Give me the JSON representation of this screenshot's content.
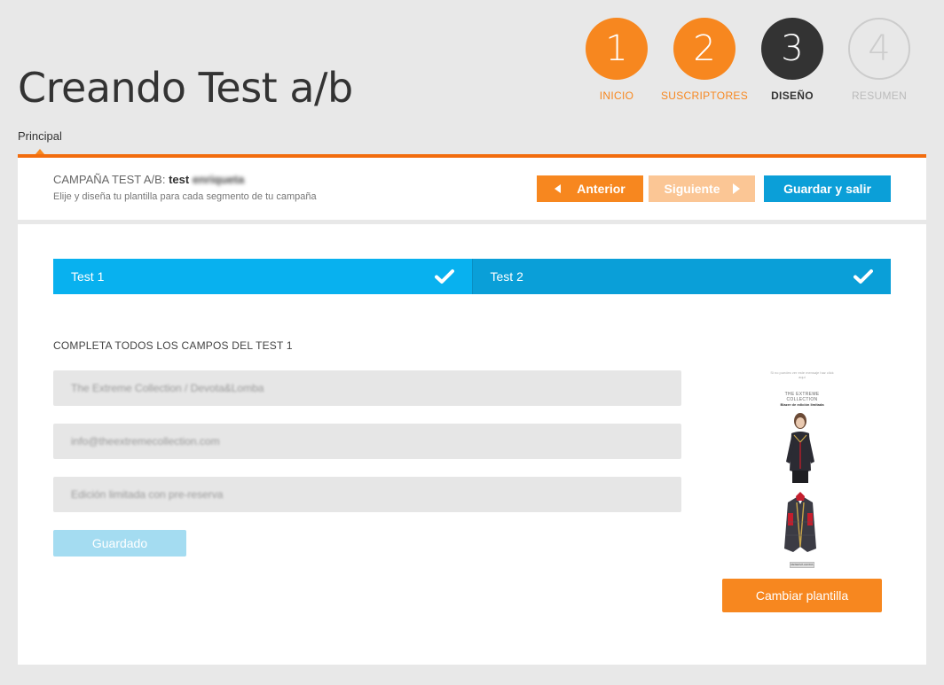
{
  "page": {
    "title": "Creando Test a/b"
  },
  "steps": [
    {
      "number": "1",
      "label": "INICIO",
      "state": "done"
    },
    {
      "number": "2",
      "label": "SUSCRIPTORES",
      "state": "done"
    },
    {
      "number": "3",
      "label": "DISEÑO",
      "state": "current"
    },
    {
      "number": "4",
      "label": "RESUMEN",
      "state": "todo"
    }
  ],
  "tabs": {
    "principal": "Principal"
  },
  "campaign": {
    "title_prefix": "CAMPAÑA TEST A/B:",
    "title_bold": "test",
    "name": "enriqueta",
    "subtitle": "Elije y diseña tu plantilla para cada segmento de tu campaña"
  },
  "toolbar": {
    "prev_label": "Anterior",
    "next_label": "Siguiente",
    "save_label": "Guardar y salir"
  },
  "test_tabs": [
    {
      "label": "Test 1",
      "completed": true
    },
    {
      "label": "Test 2",
      "completed": true
    }
  ],
  "form": {
    "section_title": "COMPLETA TODOS LOS CAMPOS DEL TEST 1",
    "sender_name": "The Extreme Collection / Devota&Lomba",
    "sender_email": "info@theextremecollection.com",
    "subject": "Edición limitada con pre-reserva",
    "saved_label": "Guardado"
  },
  "template_preview": {
    "top_text": "Si no puedes ver este mensaje haz click aquí",
    "brand": "THE EXTREME COLLECTION",
    "tagline": "Blazer de edición limitada",
    "cta": "RESERVA AHORA"
  },
  "template": {
    "change_label": "Cambiar plantilla"
  },
  "colors": {
    "orange": "#f7871f",
    "blue": "#08b1ef",
    "blue_dark": "#0a9fd8",
    "dark": "#333333"
  }
}
